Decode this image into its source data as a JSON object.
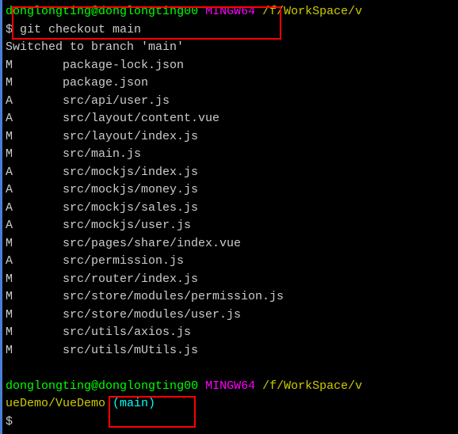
{
  "prompt1": {
    "user": "donglongting",
    "at": "@",
    "host": "donglongting00",
    "env": "MINGW64",
    "path": "/f/WorkSpace/v"
  },
  "command1": "$ git checkout main",
  "output_header": "Switched to branch 'main'",
  "files": [
    {
      "status": "M",
      "path": "package-lock.json"
    },
    {
      "status": "M",
      "path": "package.json"
    },
    {
      "status": "A",
      "path": "src/api/user.js"
    },
    {
      "status": "A",
      "path": "src/layout/content.vue"
    },
    {
      "status": "M",
      "path": "src/layout/index.js"
    },
    {
      "status": "M",
      "path": "src/main.js"
    },
    {
      "status": "A",
      "path": "src/mockjs/index.js"
    },
    {
      "status": "A",
      "path": "src/mockjs/money.js"
    },
    {
      "status": "A",
      "path": "src/mockjs/sales.js"
    },
    {
      "status": "A",
      "path": "src/mockjs/user.js"
    },
    {
      "status": "M",
      "path": "src/pages/share/index.vue"
    },
    {
      "status": "A",
      "path": "src/permission.js"
    },
    {
      "status": "M",
      "path": "src/router/index.js"
    },
    {
      "status": "M",
      "path": "src/store/modules/permission.js"
    },
    {
      "status": "M",
      "path": "src/store/modules/user.js"
    },
    {
      "status": "M",
      "path": "src/utils/axios.js"
    },
    {
      "status": "M",
      "path": "src/utils/mUtils.js"
    }
  ],
  "prompt2": {
    "user": "donglongting",
    "at": "@",
    "host": "donglongting00",
    "env": "MINGW64",
    "path_l1": "/f/WorkSpace/v",
    "path_l2": "ueDemo/VueDemo",
    "branch": " (main)"
  },
  "prompt3": "$"
}
